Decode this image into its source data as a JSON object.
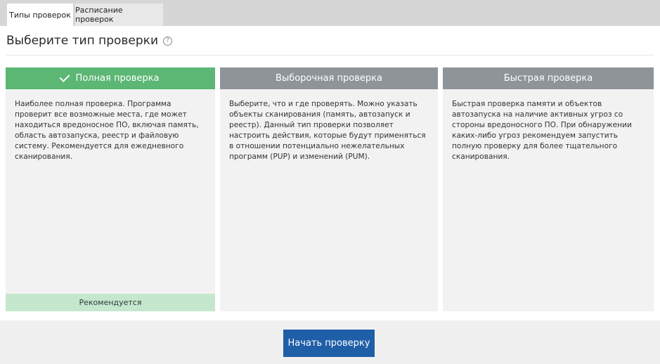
{
  "tabs": [
    {
      "label": "Типы проверок",
      "active": true
    },
    {
      "label": "Расписание проверок",
      "active": false
    }
  ],
  "heading": "Выберите тип проверки",
  "help_icon": "?",
  "cards": [
    {
      "title": "Полная проверка",
      "selected": true,
      "description": "Наиболее полная проверка. Программа проверит все возможные места, где может находиться вредоносное ПО, включая память, область автозапуска, реестр и файловую систему. Рекомендуется для ежедневного сканирования.",
      "badge": "Рекомендуется"
    },
    {
      "title": "Выборочная проверка",
      "selected": false,
      "description": "Выберите, что и где проверять. Можно указать объекты сканирования (память, автозапуск и реестр). Данный тип проверки позволяет настроить действия, которые будут применяться в отношении потенциально нежелательных программ (PUP) и изменений (PUM)."
    },
    {
      "title": "Быстрая проверка",
      "selected": false,
      "description": "Быстрая проверка памяти и объектов автозапуска на наличие активных угроз со стороны вредоносного ПО. При обнаружении каких-либо угроз рекомендуем запустить полную проверку для более тщательного сканирования."
    }
  ],
  "start_button": "Начать проверку",
  "colors": {
    "selected_header": "#5cb674",
    "unselected_header": "#8f9499",
    "recommended_bg": "#c4e7ce",
    "primary_button": "#1f5fa8"
  }
}
